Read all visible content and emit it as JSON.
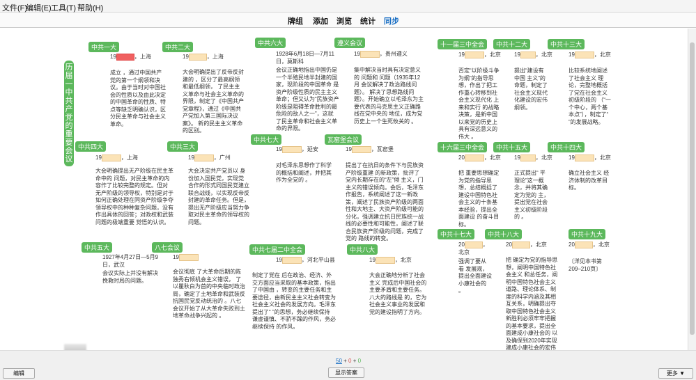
{
  "menu": {
    "file": "文件(F)",
    "edit": "编辑(E)",
    "tools": "工具(T)",
    "help": "帮助(H)"
  },
  "tabs": [
    "牌组",
    "添加",
    "浏览",
    "统计",
    "同步"
  ],
  "vertical_title": "历届一中共产党的重要会议",
  "sections": {
    "s1": {
      "tag": "中共一大",
      "l1": "19",
      "l1b": "，上海",
      "body": "成立 ，通过中国共产党的第一个纲领和决议。由于当时对中国社会的性质以及由此决定的中国革命的性质、特点等缺乏明确认识，区分民主革命与社会主义革命。"
    },
    "s2": {
      "tag": "中共二大",
      "l1": "19",
      "l1b": "，上海",
      "body": "大会明确提出了反帝反封建的 ，区分了最高纲领和最低纲领， 了民主主义革命与社会主义革命的界限，制定了《中国共产党章程》，通过《中国共产党加入第三国际决议案》。 新的民主主义革命的区别。"
    },
    "s3": {
      "tag": "中共六大",
      "l1": "1928年6月18日—7月11日，莫斯科",
      "body": "会议正确地指出中国仍是一个半殖民地半封建的国家，现阶段的中国革命 是资产阶级性质的民主主义革命；但又认为“民族资产阶级是阻碍革命胜利的最危险的敌人之一”，这就 了民主革命和社会主义革命的界限。"
    },
    "s4": {
      "tag": "遵义会议",
      "l1": "19",
      "l1b": "，贵州遵义",
      "body": "集中解决当时具有决定意义的 问题和 问题（1935年12月 会议解决了政治路线问题）。 解决了思想路线问题）。开始确立以毛泽东为主要代表的马克思主义正确路线在党中央的 地位，成为党历史上一个生死攸关的 。"
    },
    "s5": {
      "tag": "十一届三中全会",
      "l1": "19",
      "l1b": "，北京",
      "body": "否定“以阶级斗争为纲”的指导思想，作出了把工作重心转移到社会主义现代化 上来和实行 的战略决策，是新中国 以来党的历史上具有深远意义的伟大 。"
    },
    "s6": {
      "tag": "中共十二大",
      "l1": "19",
      "l1b": "，北京",
      "body": "提出“建设有中国 主义”的命题，制定了社会主义现代化建设的宏伟纲领。"
    },
    "s7": {
      "tag": "中共十三大",
      "l1": "19",
      "l1b": "，北京",
      "body": "比较系统地阐述了社会主义 理论，完整地概括了党在社会主义初级阶段的 （“一个中心，两个基本点”），制定了“ ”的发展战略。"
    },
    "s8": {
      "tag": "中共四大",
      "l1": "19",
      "l1b": "，上海",
      "body": "大会明确提出无产阶级在民主革命中的 问题，对民主革命的内容作了比较完整的规定。但对 无产阶级的领导权，特别是对于如何正确处理在同资产阶级争夺领导权中的种种复杂问题，没有作出具体的回答；对政权和武装问题的极端重要 觉悟的认识。"
    },
    "s9": {
      "tag": "中共三大",
      "l1": "19",
      "l1b": "，广州",
      "body": "大会决定共产党员以 身份加入国民党，实现党 合作的形式同国民党建立联合战线，以实现反帝反封建的革命任务。但是， 提出无产阶级应当努力争取对民主革命的领导权的问题。"
    },
    "s10": {
      "tag": "中共七大",
      "l1": "19",
      "l1b": "，延安",
      "body": "对毛泽东思想作了科学的概括和阐述，并把其作为全党的 。"
    },
    "s11": {
      "tag": "瓦窑堡会议",
      "l1": "19",
      "l1b": "，瓦窑堡",
      "body": "提出了在抗日的条件下与民族资产阶级重建 的新政策，批评了党内长期存在的“左”倾 主义，门主义的错误倾向。会后，毛泽东作报告，系统阐述了这一新政策，阐述了民族资产阶级的两面性和大地主、大资产阶级可能的分化，强调建立抗日民族统一战线的必要性和可能性，阐述了联合民族资产阶级的问题，完成了党的 路线的转变。"
    },
    "s12": {
      "tag": "十六届三中全会",
      "l1": "20",
      "l1b": "，北京",
      "body": "把 重要思想确定为党的指导思想，总结概括了建设中国特色社会主义的十条基本经验，提出全面建设 的奋斗目标。"
    },
    "s13": {
      "tag": "中共十五大",
      "l1": "19",
      "l1b": "，北京",
      "body": "正式提出“ 平理论”这一概念，并将其确定为党的 主，提出党在社会主义初级阶段的 。"
    },
    "s14": {
      "tag": "中共十四大",
      "l1": "19",
      "l1b": "，北京",
      "body": "确立社会主义 经济体制的改革目标。"
    },
    "s15": {
      "tag": "中共五大",
      "l1": "1927年4月27日—5月9日，武汉",
      "body": "会议实际上并没有解决挽救时局的问题。"
    },
    "s16": {
      "tag": "八七会议",
      "l1": "19",
      "l1b": "",
      "body": "会议彻底 了大革命后期的陈独秀右倾机会主义错误， 了以瞿秋白为首的中央临时政治局，确定了土地革命和武装反抗国民党反动统治的 。八七会议开始了从大革命失败到土地革命战争兴起的 。"
    },
    "s17": {
      "tag": "中共七届二中全会",
      "l1": "19",
      "l1b": "，河北平山县",
      "body": "制定了党在 后在政治、经济、外交方面应当采取的基本政策，指出了中国由 ，转变的主要任务和主要途径，由新民主主义社会转变为社会主义社会的发展方向。毛泽东提出了“ ”的思想，务必继续保持 谦虚谨慎、不骄不躁的作风，务必继续保持 的作风。"
    },
    "s18": {
      "tag": "中共八大",
      "l1": "19",
      "l1b": "，北京",
      "body": "大会正确地分析了社会主义 完成后中国社会的主要矛盾和主要任务。八大的路线是 的，它为社会主义事业的发展和党的建设指明了方向。"
    },
    "s19": {
      "tag": "中共十七大",
      "l1": "20",
      "l1b": "，北京",
      "body": "强调了要从 看 发展观，提出全面建设小康社会的 。"
    },
    "s20": {
      "tag": "中共十八大",
      "l1": "20",
      "l1b": "，北京",
      "body": "把 确定为党的指导思想，阐明中国特色社会主义 和总任务，阐明中国特色社会主义道路、理论体系、制度的科学内涵及其相互关系，明确提出夺取中国特色社会主义新胜利必须牢牢把握的基本要求，提出全面建成小康社会的 以及确保到2020年实现 建成小康社会的宏伟目标。"
    },
    "s21": {
      "tag": "中共十九大",
      "l1": "20",
      "l1b": "，北京",
      "body": "〔洋见本书第209–210页〕"
    }
  },
  "pager": {
    "current": "50",
    "sep1": " + ",
    "new": "0",
    "sep2": " + ",
    "due": "0"
  },
  "buttons": {
    "edit": "编辑",
    "show_answer": "显示答案",
    "more": "更多 ▼"
  }
}
